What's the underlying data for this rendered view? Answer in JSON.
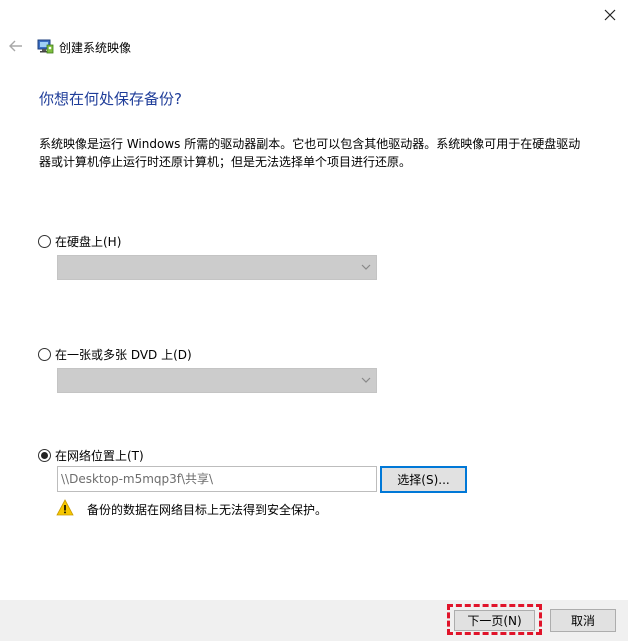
{
  "window": {
    "title": "创建系统映像",
    "back_icon": "back-arrow-icon",
    "close_icon": "close-icon",
    "app_icon": "system-image-icon"
  },
  "main": {
    "heading": "你想在何处保存备份?",
    "description": "系统映像是运行 Windows 所需的驱动器副本。它也可以包含其他驱动器。系统映像可用于在硬盘驱动器或计算机停止运行时还原计算机；但是无法选择单个项目进行还原。"
  },
  "options": {
    "hard_disk": {
      "label": "在硬盘上(H)",
      "selected": false,
      "dropdown_value": ""
    },
    "dvd": {
      "label": "在一张或多张 DVD 上(D)",
      "selected": false,
      "dropdown_value": ""
    },
    "network": {
      "label": "在网络位置上(T)",
      "selected": true,
      "path": "\\\\Desktop-m5mqp3f\\共享\\",
      "browse_label": "选择(S)..."
    }
  },
  "warning": {
    "icon": "warning-icon",
    "text": "备份的数据在网络目标上无法得到安全保护。"
  },
  "footer": {
    "next_label": "下一页(N)",
    "cancel_label": "取消",
    "highlight_color": "#e0142a"
  },
  "colors": {
    "heading": "#1f3d99",
    "accent": "#0078d7",
    "warning": "#f6c700"
  }
}
